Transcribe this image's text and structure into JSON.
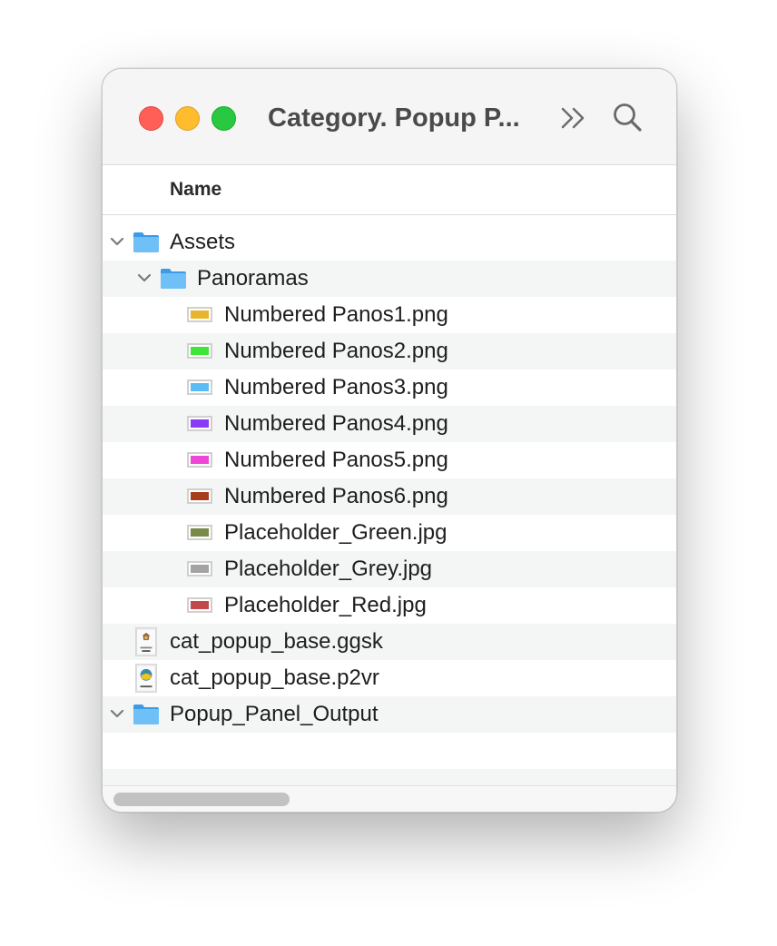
{
  "window": {
    "title": "Category. Popup P..."
  },
  "icons": {
    "close": "close-icon",
    "minimize": "minimize-icon",
    "zoom": "zoom-icon",
    "more": "double-chevron-right-icon",
    "search": "search-icon"
  },
  "columns": {
    "name": "Name"
  },
  "tree": {
    "assets": "Assets",
    "panoramas": "Panoramas",
    "files": [
      {
        "name": "Numbered Panos1.png",
        "color": "#e9b42e"
      },
      {
        "name": "Numbered Panos2.png",
        "color": "#3ee63a"
      },
      {
        "name": "Numbered Panos3.png",
        "color": "#5bbcf5"
      },
      {
        "name": "Numbered Panos4.png",
        "color": "#8a3cf5"
      },
      {
        "name": "Numbered Panos5.png",
        "color": "#ee47d7"
      },
      {
        "name": "Numbered Panos6.png",
        "color": "#a83d1c"
      },
      {
        "name": "Placeholder_Green.jpg",
        "color": "#7a8a48"
      },
      {
        "name": "Placeholder_Grey.jpg",
        "color": "#a3a3a3"
      },
      {
        "name": "Placeholder_Red.jpg",
        "color": "#c4474a"
      }
    ],
    "ggsk": "cat_popup_base.ggsk",
    "p2vr": "cat_popup_base.p2vr",
    "output": "Popup_Panel_Output"
  },
  "colors": {
    "folder": "#5fb3f2",
    "folder_dark": "#3d9ae6"
  }
}
